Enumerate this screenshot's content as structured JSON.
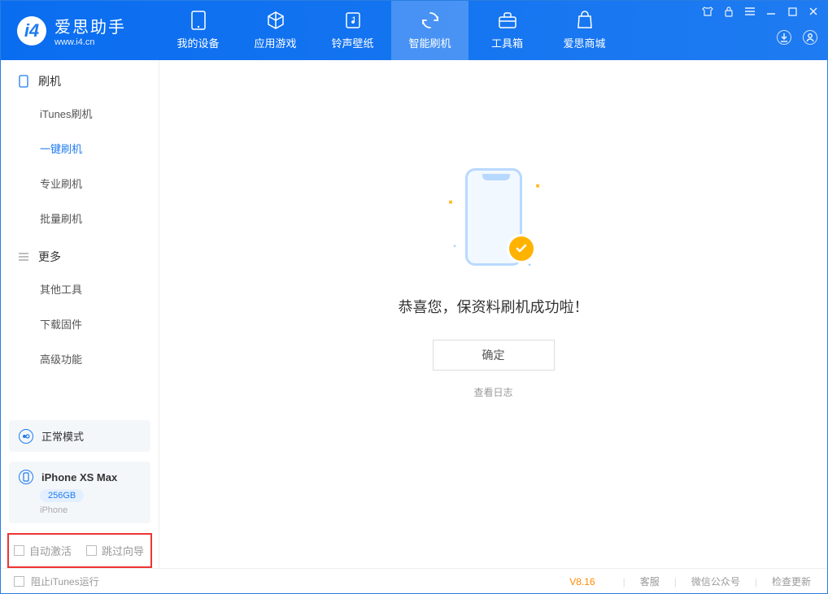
{
  "app": {
    "name": "爱思助手",
    "url": "www.i4.cn"
  },
  "nav": {
    "device": "我的设备",
    "apps": "应用游戏",
    "ringtone": "铃声壁纸",
    "flash": "智能刷机",
    "toolbox": "工具箱",
    "store": "爱思商城"
  },
  "sidebar": {
    "group1_title": "刷机",
    "group1_items": [
      "iTunes刷机",
      "一键刷机",
      "专业刷机",
      "批量刷机"
    ],
    "group2_title": "更多",
    "group2_items": [
      "其他工具",
      "下载固件",
      "高级功能"
    ]
  },
  "mode": {
    "label": "正常模式"
  },
  "device": {
    "name": "iPhone XS Max",
    "capacity": "256GB",
    "type": "iPhone"
  },
  "options": {
    "auto_activate": "自动激活",
    "skip_guide": "跳过向导"
  },
  "main": {
    "message": "恭喜您，保资料刷机成功啦！",
    "ok": "确定",
    "view_log": "查看日志"
  },
  "footer": {
    "block_itunes": "阻止iTunes运行",
    "version": "V8.16",
    "support": "客服",
    "wechat": "微信公众号",
    "update": "检查更新"
  }
}
